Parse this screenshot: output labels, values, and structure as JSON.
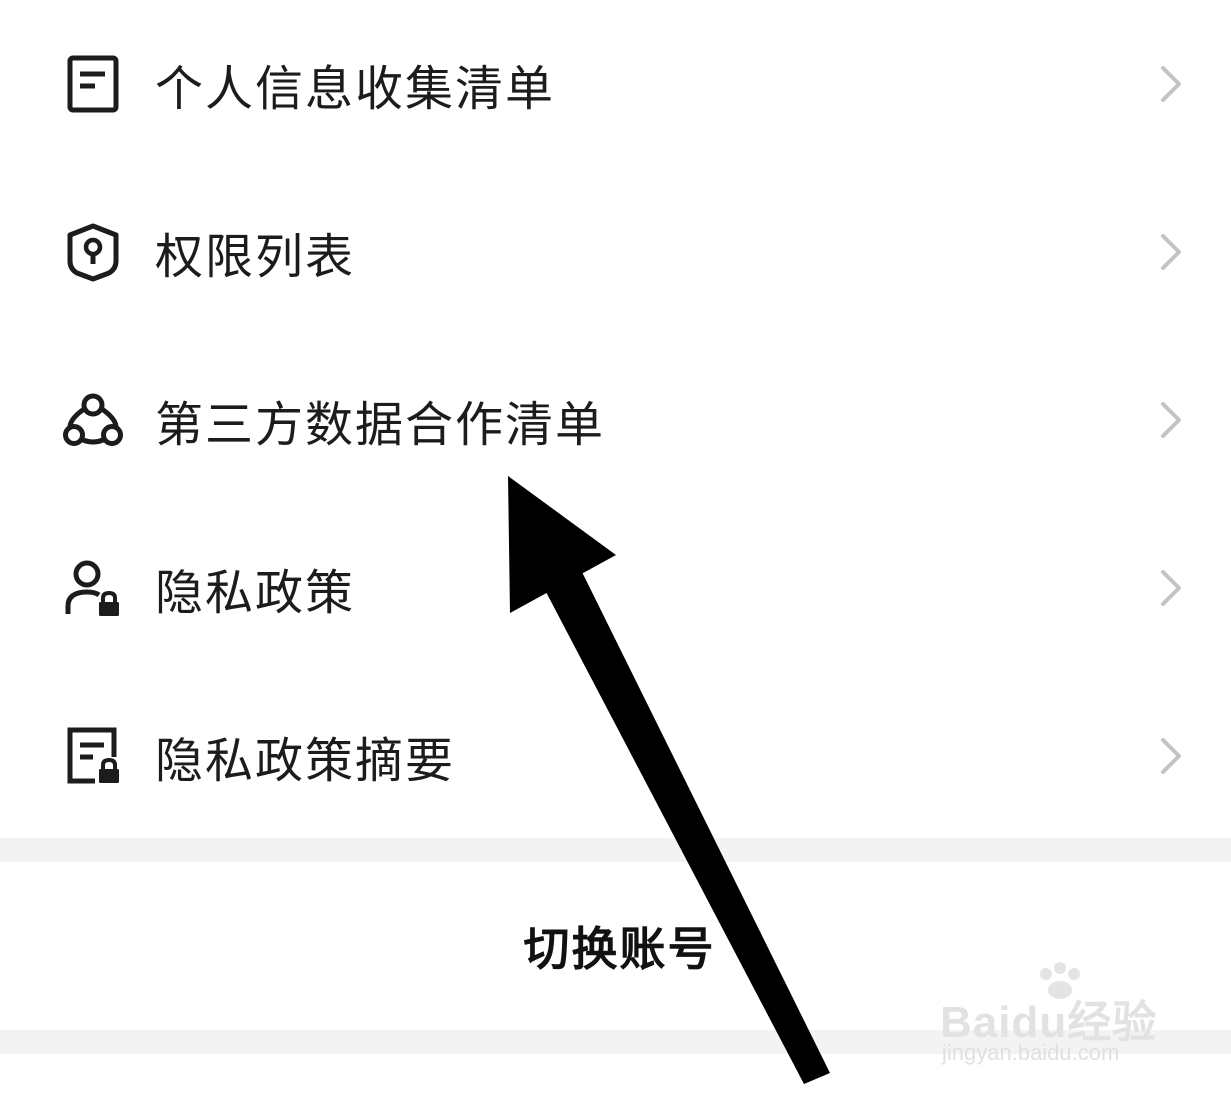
{
  "menu": {
    "items": [
      {
        "label": "个人信息收集清单",
        "icon": "document-list-icon"
      },
      {
        "label": "权限列表",
        "icon": "shield-keyhole-icon"
      },
      {
        "label": "第三方数据合作清单",
        "icon": "network-nodes-icon"
      },
      {
        "label": "隐私政策",
        "icon": "user-lock-icon"
      },
      {
        "label": "隐私政策摘要",
        "icon": "document-lock-icon"
      }
    ],
    "chevron_icon": "chevron-right-icon"
  },
  "account": {
    "switch_label": "切换账号"
  },
  "watermark": {
    "brand": "Baidu经验",
    "url": "jingyan.baidu.com"
  },
  "colors": {
    "text": "#1c1c1c",
    "chevron": "#c4c4c4",
    "divider": "#f3f3f3",
    "arrow": "#000000"
  }
}
